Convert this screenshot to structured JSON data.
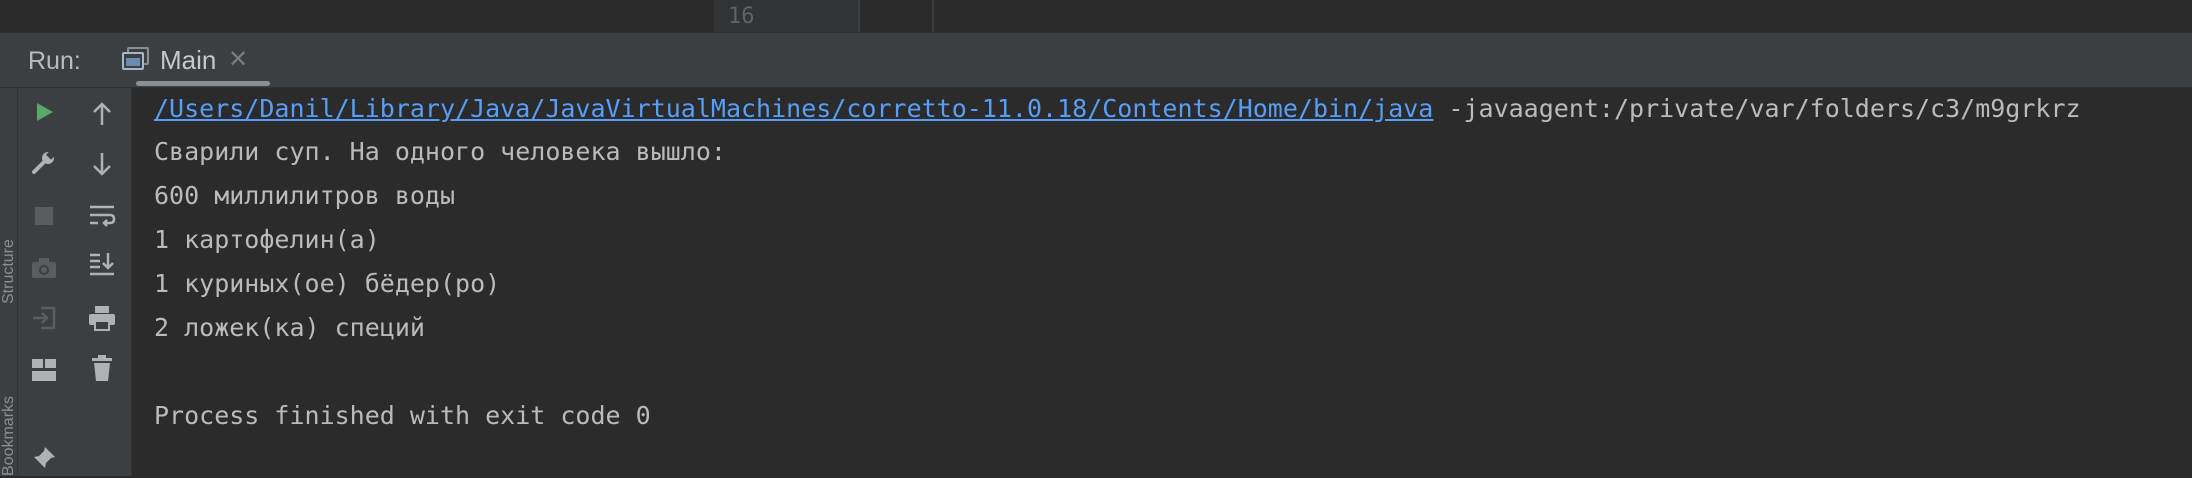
{
  "editor": {
    "line_number": "16"
  },
  "run_panel": {
    "label": "Run:",
    "tab": {
      "label": "Main",
      "close_symbol": "✕"
    }
  },
  "side_tabs": {
    "structure": "Structure",
    "bookmarks": "Bookmarks"
  },
  "toolbar": {
    "left_column": [
      "run-icon",
      "wrench-icon",
      "stop-icon",
      "camera-icon",
      "login-icon",
      "layout-icon",
      "pin-icon"
    ],
    "right_column": [
      "arrow-up-icon",
      "arrow-down-icon",
      "soft-wrap-icon",
      "scroll-to-end-icon",
      "print-icon",
      "trash-icon"
    ]
  },
  "console": {
    "command_path": "/Users/Danil/Library/Java/JavaVirtualMachines/corretto-11.0.18/Contents/Home/bin/java",
    "command_args": " -javaagent:/private/var/folders/c3/m9grkrz",
    "lines": [
      "Сварили суп. На одного человека вышло:",
      "600 миллилитров воды",
      "1 картофелин(а)",
      "1 куриных(ое) бёдер(ро)",
      "2 ложек(ка) специй",
      "",
      "Process finished with exit code 0"
    ]
  },
  "colors": {
    "link": "#589df6",
    "run_green": "#59a869",
    "console_text": "#bbbbbb",
    "panel_bg": "#3c3f41",
    "console_bg": "#2b2b2b"
  }
}
